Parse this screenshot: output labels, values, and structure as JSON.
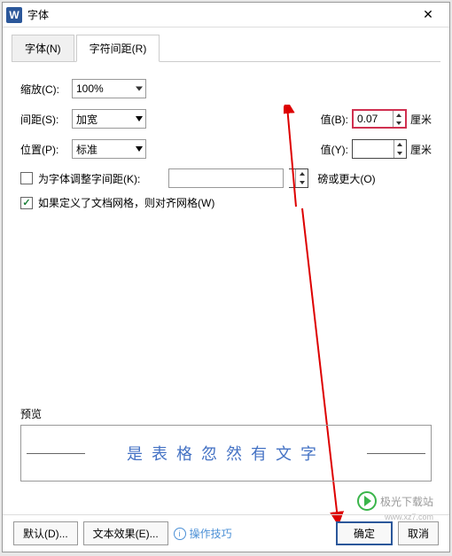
{
  "titlebar": {
    "title": "字体"
  },
  "tabs": {
    "font": "字体(N)",
    "spacing": "字符间距(R)"
  },
  "form": {
    "scale": {
      "label": "缩放(C):",
      "value": "100%"
    },
    "spacing": {
      "label": "间距(S):",
      "value": "加宽",
      "val_label": "值(B):",
      "val": "0.07",
      "unit": "厘米"
    },
    "position": {
      "label": "位置(P):",
      "value": "标准",
      "val_label": "值(Y):",
      "val": "",
      "unit": "厘米"
    },
    "kerning": {
      "label": "为字体调整字间距(K):",
      "unit": "磅或更大(O)"
    },
    "grid": {
      "label": "如果定义了文档网格，则对齐网格(W)"
    }
  },
  "preview": {
    "label": "预览",
    "text": "是表格忽然有文字"
  },
  "footer": {
    "default": "默认(D)...",
    "effects": "文本效果(E)...",
    "tips": "操作技巧",
    "ok": "确定",
    "cancel": "取消"
  },
  "watermark": {
    "name": "极光下载站",
    "url": "www.xz7.com"
  }
}
